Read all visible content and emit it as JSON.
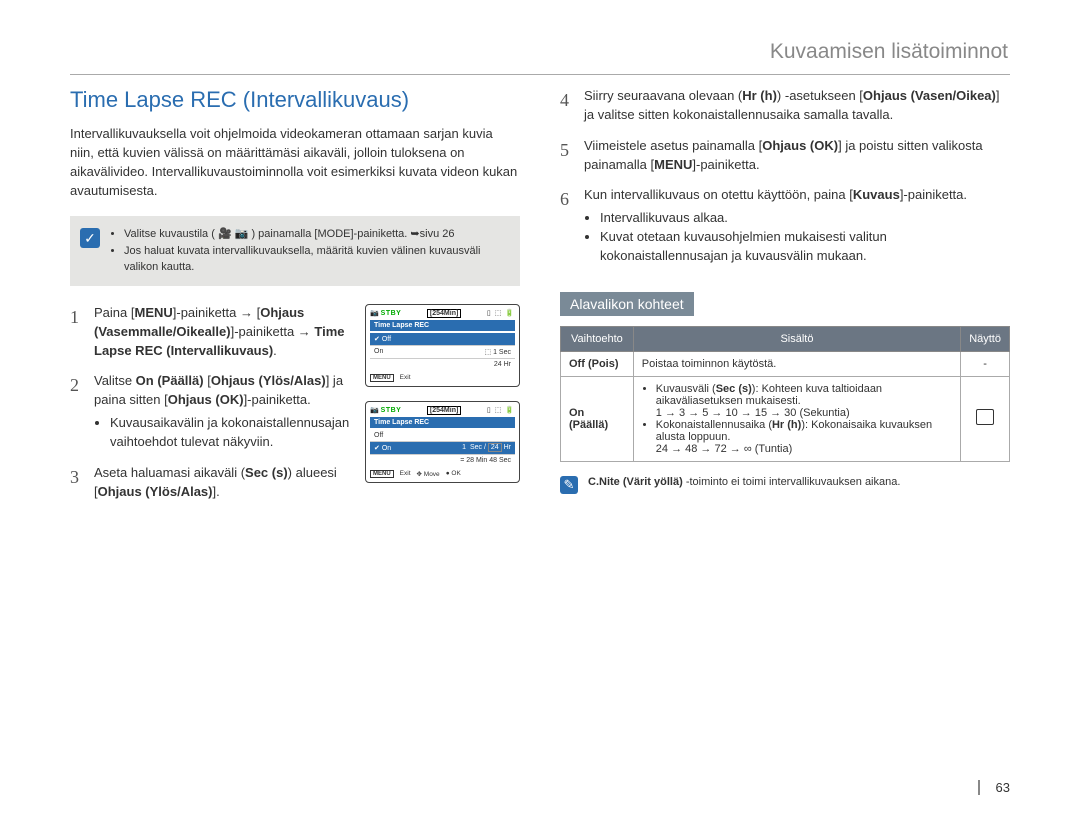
{
  "page_number": "63",
  "breadcrumb": "Kuvaamisen lisätoiminnot",
  "section_title": "Time Lapse REC (Intervallikuvaus)",
  "intro": "Intervallikuvauksella voit ohjelmoida videokameran ottamaan sarjan kuvia niin, että kuvien välissä on määrittämäsi aikaväli, jolloin tuloksena on aikavälivideo. Intervallikuvaustoiminnolla voit esimerkiksi kuvata videon kukan avautumisesta.",
  "note_items": [
    "Valitse kuvaustila ( 🎥 📷 ) painamalla [MODE]-painiketta. ➥sivu 26",
    "Jos haluat kuvata intervallikuvauksella, määritä kuvien välinen kuvausväli valikon kautta."
  ],
  "steps_left": [
    {
      "num": "1",
      "html": "Paina [<b>MENU</b>]-painiketta → [<b>Ohjaus (Vasemmalle/Oikealle)</b>]-painiketta → <b>Time Lapse REC (Intervallikuvaus)</b>."
    },
    {
      "num": "2",
      "html": "Valitse <b>On (Päällä)</b> [<b>Ohjaus (Ylös/Alas)</b>] ja paina sitten [<b>Ohjaus (OK)</b>]-painiketta.",
      "sub": [
        "Kuvausaikavälin ja kokonaistallennusajan vaihtoehdot tulevat näkyviin."
      ]
    },
    {
      "num": "3",
      "html": "Aseta haluamasi aikaväli (<b>Sec (s)</b>) alueesi [<b>Ohjaus (Ylös/Alas)</b>]."
    }
  ],
  "steps_right": [
    {
      "num": "4",
      "html": "Siirry seuraavana olevaan (<b>Hr (h)</b>) -asetukseen [<b>Ohjaus (Vasen/Oikea)</b>] ja valitse sitten kokonaistallennusaika samalla tavalla."
    },
    {
      "num": "5",
      "html": "Viimeistele asetus painamalla [<b>Ohjaus (OK)</b>] ja poistu sitten valikosta painamalla [<b>MENU</b>]-painiketta."
    },
    {
      "num": "6",
      "html": "Kun intervallikuvaus on otettu käyttöön, paina [<b>Kuvaus</b>]-painiketta.",
      "sub": [
        "Intervallikuvaus alkaa.",
        "Kuvat otetaan kuvausohjelmien mukaisesti valitun kokonaistallennusajan ja kuvausvälin mukaan."
      ]
    }
  ],
  "screen1": {
    "stby": "STBY",
    "time": "[254Min]",
    "title": "Time Lapse REC",
    "row_off": "Off",
    "row_on": "On",
    "right1": "1 Sec",
    "right2": "24 Hr",
    "menu": "MENU",
    "exit": "Exit"
  },
  "screen2": {
    "stby": "STBY",
    "time": "[254Min]",
    "title": "Time Lapse REC",
    "row_off": "Off",
    "row_on": "On",
    "sec_val": "1",
    "sec_lbl": "Sec /",
    "hr_val": "24",
    "hr_lbl": "Hr",
    "calc": "= 28 Min 48 Sec",
    "menu": "MENU",
    "exit": "Exit",
    "move": "Move",
    "ok": "OK"
  },
  "subhead": "Alavalikon kohteet",
  "table": {
    "headers": [
      "Vaihtoehto",
      "Sisältö",
      "Näyttö"
    ],
    "rows": [
      {
        "opt": "Off (Pois)",
        "content_plain": "Poistaa toiminnon käytöstä.",
        "display": "-"
      },
      {
        "opt": "On (Päällä)",
        "content_html": "<ul><li>Kuvausväli (<b>Sec (s)</b>): Kohteen kuva taltioidaan aikaväliasetuksen mukaisesti.<br>1 → 3 → 5 → 10 → 15 → 30 (Sekuntia)</li><li>Kokonaistallennusaika (<b>Hr (h)</b>): Kokonaisaika kuvauksen alusta loppuun.<br>24 → 48 → 72 → ∞ (Tuntia)</li></ul>",
        "display_icon": true
      }
    ]
  },
  "footnote": "C.Nite (Värit yöllä) -toiminto ei toimi intervallikuvauksen aikana.",
  "footnote_bold": "C.Nite (Värit yöllä)"
}
